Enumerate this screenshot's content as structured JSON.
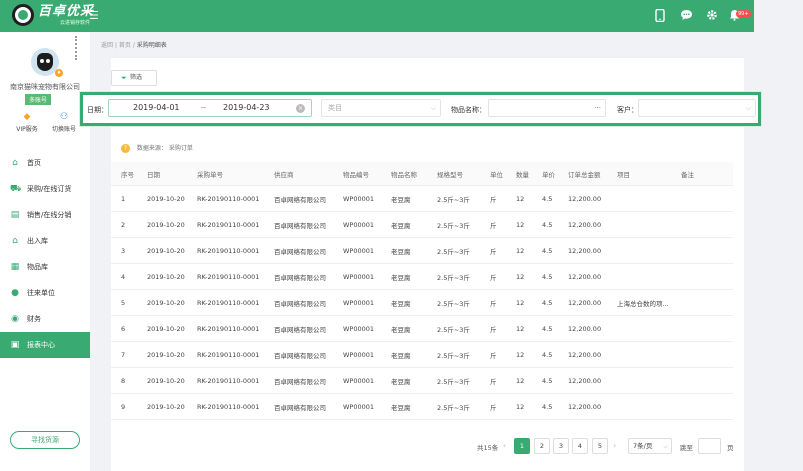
{
  "header": {
    "logo_title": "百卓优采",
    "logo_sub": "云进销存软件",
    "notification_badge": "99+"
  },
  "sidebar": {
    "company": "南京猫咪宠物有限公司",
    "multi_account": "多账号",
    "vip_label": "VIP服务",
    "switch_label": "切换账号",
    "items": [
      {
        "label": "首页",
        "icon": "home-icon"
      },
      {
        "label": "采购/在线订货",
        "icon": "cart-icon"
      },
      {
        "label": "销售/在线分销",
        "icon": "document-icon"
      },
      {
        "label": "出入库",
        "icon": "warehouse-icon"
      },
      {
        "label": "物品库",
        "icon": "goods-icon"
      },
      {
        "label": "往来单位",
        "icon": "contacts-icon"
      },
      {
        "label": "财务",
        "icon": "finance-icon"
      },
      {
        "label": "报表中心",
        "icon": "report-icon"
      }
    ],
    "find_button": "寻找货源"
  },
  "breadcrumb": {
    "back": "返回",
    "sep1": "|",
    "home": "首页",
    "sep2": "/",
    "current": "采购明细表"
  },
  "toolbar": {
    "filter_label": "筛选"
  },
  "filters": {
    "date_label": "日期：",
    "date_start": "2019-04-01",
    "date_sep": "~",
    "date_end": "2019-04-23",
    "category_placeholder": "类目",
    "item_name_label": "物品名称：",
    "item_more": "···",
    "customer_label": "客户："
  },
  "source": {
    "label": "数据来源：",
    "value": "采购订单"
  },
  "table": {
    "headers": [
      "序号",
      "日期",
      "采购单号",
      "供应商",
      "物品编号",
      "物品名称",
      "规格型号",
      "单位",
      "数量",
      "单价",
      "订单总金额",
      "项目",
      "备注"
    ],
    "rows": [
      [
        "1",
        "2019-10-20",
        "RK-20190110-0001",
        "百卓网络有限公司",
        "WP00001",
        "老豆腐",
        "2.5斤~3斤",
        "斤",
        "12",
        "4.5",
        "12,200.00",
        "",
        ""
      ],
      [
        "2",
        "2019-10-20",
        "RK-20190110-0001",
        "百卓网络有限公司",
        "WP00001",
        "老豆腐",
        "2.5斤~3斤",
        "斤",
        "12",
        "4.5",
        "12,200.00",
        "",
        ""
      ],
      [
        "3",
        "2019-10-20",
        "RK-20190110-0001",
        "百卓网络有限公司",
        "WP00001",
        "老豆腐",
        "2.5斤~3斤",
        "斤",
        "12",
        "4.5",
        "12,200.00",
        "",
        ""
      ],
      [
        "4",
        "2019-10-20",
        "RK-20190110-0001",
        "百卓网络有限公司",
        "WP00001",
        "老豆腐",
        "2.5斤~3斤",
        "斤",
        "12",
        "4.5",
        "12,200.00",
        "",
        ""
      ],
      [
        "5",
        "2019-10-20",
        "RK-20190110-0001",
        "百卓网络有限公司",
        "WP00001",
        "老豆腐",
        "2.5斤~3斤",
        "斤",
        "12",
        "4.5",
        "12,200.00",
        "上海总仓数的项...",
        ""
      ],
      [
        "6",
        "2019-10-20",
        "RK-20190110-0001",
        "百卓网络有限公司",
        "WP00001",
        "老豆腐",
        "2.5斤~3斤",
        "斤",
        "12",
        "4.5",
        "12,200.00",
        "",
        ""
      ],
      [
        "7",
        "2019-10-20",
        "RK-20190110-0001",
        "百卓网络有限公司",
        "WP00001",
        "老豆腐",
        "2.5斤~3斤",
        "斤",
        "12",
        "4.5",
        "12,200.00",
        "",
        ""
      ],
      [
        "8",
        "2019-10-20",
        "RK-20190110-0001",
        "百卓网络有限公司",
        "WP00001",
        "老豆腐",
        "2.5斤~3斤",
        "斤",
        "12",
        "4.5",
        "12,200.00",
        "",
        ""
      ],
      [
        "9",
        "2019-10-20",
        "RK-20190110-0001",
        "百卓网络有限公司",
        "WP00001",
        "老豆腐",
        "2.5斤~3斤",
        "斤",
        "12",
        "4.5",
        "12,200.00",
        "",
        ""
      ]
    ]
  },
  "pagination": {
    "total": "共15条",
    "pages": [
      "1",
      "2",
      "3",
      "4",
      "5"
    ],
    "current_page": "1",
    "page_size": "7条/页",
    "jump_label": "跳至",
    "page_unit": "页"
  },
  "colors": {
    "brand": "#3aaa73",
    "badge": "#ff4d4f"
  }
}
